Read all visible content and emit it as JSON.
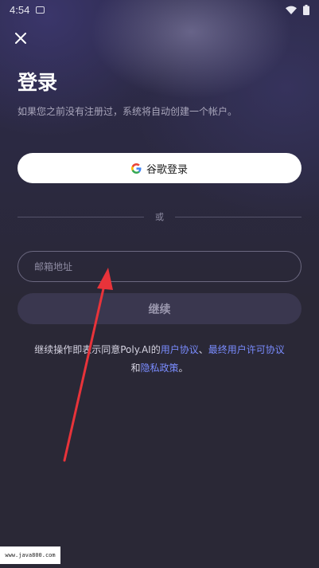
{
  "status_bar": {
    "time": "4:54"
  },
  "header": {
    "title": "登录",
    "subtitle": "如果您之前没有注册过，系统将自动创建一个帐户。"
  },
  "google_login": {
    "label": "谷歌登录"
  },
  "divider": {
    "label": "或"
  },
  "email": {
    "placeholder": "邮箱地址",
    "value": ""
  },
  "continue_button": {
    "label": "继续"
  },
  "terms": {
    "prefix": "继续操作即表示同意Poly.AI的",
    "user_agreement": "用户协议",
    "sep1": "、",
    "eula": "最终用户许可协议",
    "and": "和",
    "privacy": "隐私政策",
    "suffix": "。"
  },
  "watermark": {
    "text": "www.java800.com"
  },
  "colors": {
    "background": "#2a2836",
    "link": "#7a8cff",
    "button_disabled": "#3a374f",
    "annotation_arrow": "#e8333a"
  },
  "icons": {
    "close": "close-icon",
    "google": "google-logo-icon",
    "wifi": "wifi-icon",
    "battery": "battery-icon"
  }
}
